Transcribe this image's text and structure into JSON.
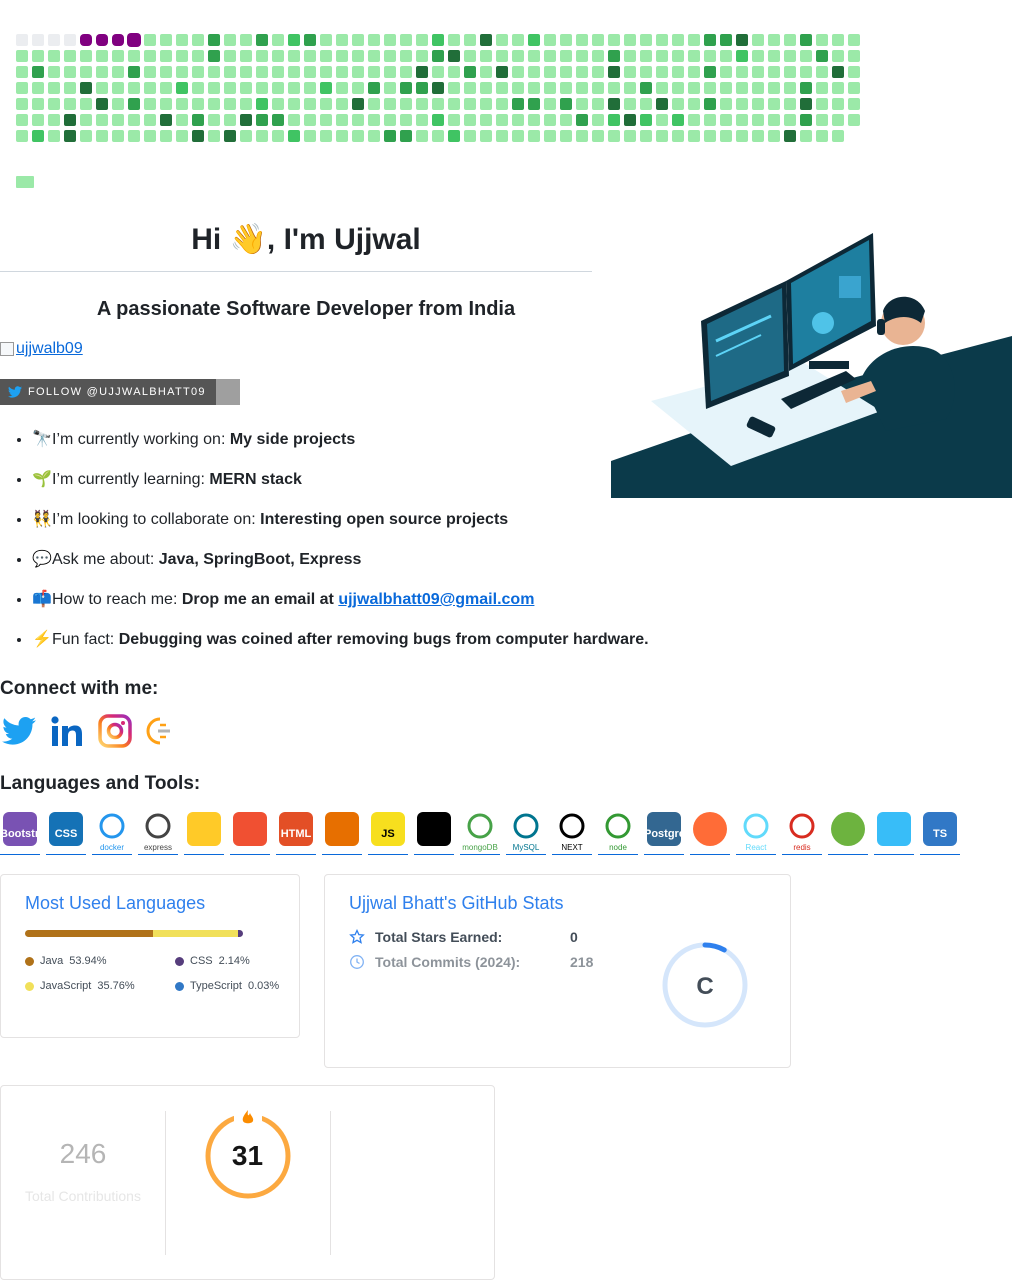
{
  "hero": {
    "greeting": "Hi",
    "wave": "👋",
    "rest": ", I'm Ujjwal",
    "subtitle": "A passionate Software Developer from India",
    "broken_image_alt": "ujjwalb09",
    "follow_label": "FOLLOW @UJJWALBHATT09"
  },
  "facts": [
    {
      "emoji": "🔭",
      "label": "I’m currently working on: ",
      "value": "My side projects"
    },
    {
      "emoji": "🌱",
      "label": "I’m currently learning: ",
      "value": "MERN stack"
    },
    {
      "emoji": "👯",
      "label": "I’m looking to collaborate on: ",
      "value": "Interesting open source projects"
    },
    {
      "emoji": "💬",
      "label": "Ask me about: ",
      "value": "Java, SpringBoot, Express"
    },
    {
      "emoji": "📫",
      "label": "How to reach me: ",
      "value": "Drop me an email at ",
      "link": "ujjwalbhatt09@gmail.com"
    },
    {
      "emoji": "⚡",
      "label": "Fun fact: ",
      "value": "Debugging was coined after removing bugs from computer hardware."
    }
  ],
  "sections": {
    "connect": "Connect with me:",
    "tools": "Languages and Tools:"
  },
  "social": [
    "twitter-icon",
    "linkedin-icon",
    "instagram-icon",
    "hackerrank-icon"
  ],
  "tools": [
    {
      "name": "bootstrap-icon",
      "text": "Bootstrap",
      "color": "#7952b3"
    },
    {
      "name": "css3-icon",
      "text": "CSS",
      "color": "#1572b6"
    },
    {
      "name": "docker-icon",
      "text": "docker",
      "color": "#2496ed"
    },
    {
      "name": "express-icon",
      "text": "express",
      "color": "#444444"
    },
    {
      "name": "firebase-icon",
      "text": "",
      "color": "#ffca28"
    },
    {
      "name": "git-icon",
      "text": "",
      "color": "#f05032"
    },
    {
      "name": "html5-icon",
      "text": "HTML",
      "color": "#e34f26"
    },
    {
      "name": "java-icon",
      "text": "",
      "color": "#e76f00"
    },
    {
      "name": "javascript-icon",
      "text": "JS",
      "color": "#f7df1e"
    },
    {
      "name": "linux-icon",
      "text": "",
      "color": "#000000"
    },
    {
      "name": "mongodb-icon",
      "text": "mongoDB",
      "color": "#47a248"
    },
    {
      "name": "mysql-icon",
      "text": "MySQL",
      "color": "#00758f"
    },
    {
      "name": "nextjs-icon",
      "text": "NEXT",
      "color": "#000000"
    },
    {
      "name": "nodejs-icon",
      "text": "node",
      "color": "#339933"
    },
    {
      "name": "postgresql-icon",
      "text": "PostgreSQL",
      "color": "#336791"
    },
    {
      "name": "postman-icon",
      "text": "",
      "color": "#ff6c37"
    },
    {
      "name": "react-icon",
      "text": "React",
      "color": "#61dafb"
    },
    {
      "name": "redis-icon",
      "text": "redis",
      "color": "#d82c20"
    },
    {
      "name": "spring-icon",
      "text": "",
      "color": "#6db33f"
    },
    {
      "name": "tailwind-icon",
      "text": "",
      "color": "#38bdf8"
    },
    {
      "name": "typescript-icon",
      "text": "TS",
      "color": "#3178c6"
    }
  ],
  "languages": {
    "title": "Most Used Languages",
    "items": [
      {
        "name": "Java",
        "percent": "53.94%",
        "value": 53.94,
        "color": "#b07219"
      },
      {
        "name": "JavaScript",
        "percent": "35.76%",
        "value": 35.76,
        "color": "#f1e05a"
      },
      {
        "name": "CSS",
        "percent": "2.14%",
        "value": 2.14,
        "color": "#563d7c"
      },
      {
        "name": "TypeScript",
        "percent": "0.03%",
        "value": 0.03,
        "color": "#3178c6"
      }
    ]
  },
  "stats": {
    "title": "Ujjwal Bhatt's GitHub Stats",
    "stars_label": "Total Stars Earned:",
    "stars_value": "0",
    "commits_label": "Total Commits (2024):",
    "commits_value": "218",
    "rank": "C",
    "rank_progress": 0.08,
    "accent": "#2f80ed"
  },
  "streak": {
    "total": "246",
    "total_label": "Total Contributions",
    "current": "31",
    "ring_color": "#fb8c00"
  },
  "grid_colors": {
    "l1": "#9be9a8",
    "l2": "#40c463",
    "l3": "#30a14e",
    "l4": "#216e39",
    "empty": "#ebedf0",
    "snake": "#800080"
  }
}
